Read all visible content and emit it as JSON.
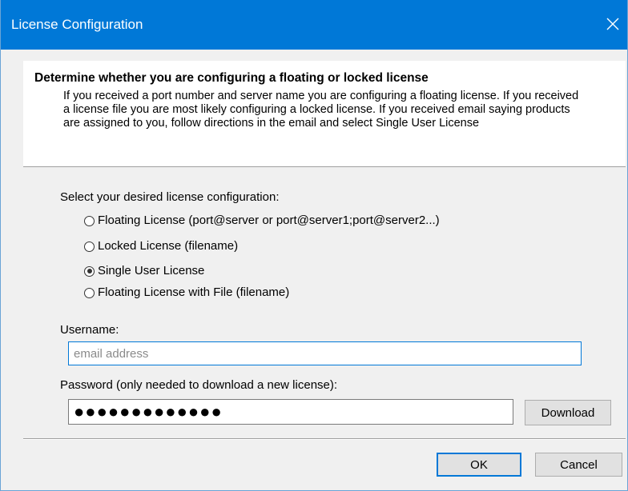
{
  "window": {
    "title": "License Configuration",
    "accent_color": "#0078d7",
    "close_icon": "close-icon"
  },
  "header": {
    "title": "Determine whether you are configuring a floating or locked license",
    "description": "If you received a port number and server name you are configuring a floating license. If you received a license file you are most likely configuring a locked license.  If you received email saying products are assigned to you, follow directions in the email and select Single User License"
  },
  "config": {
    "prompt": "Select your desired license configuration:",
    "options": [
      {
        "label": "Floating License (port@server or port@server1;port@server2...)",
        "selected": false
      },
      {
        "label": "Locked License (filename)",
        "selected": false
      },
      {
        "label": "Single User License",
        "selected": true
      },
      {
        "label": "Floating License with File (filename)",
        "selected": false
      }
    ]
  },
  "username": {
    "label": "Username:",
    "value": "",
    "placeholder": "email address"
  },
  "password": {
    "label": "Password (only needed to download a new license):",
    "value": "●●●●●●●●●●●●●"
  },
  "buttons": {
    "download": "Download",
    "ok": "OK",
    "cancel": "Cancel"
  }
}
